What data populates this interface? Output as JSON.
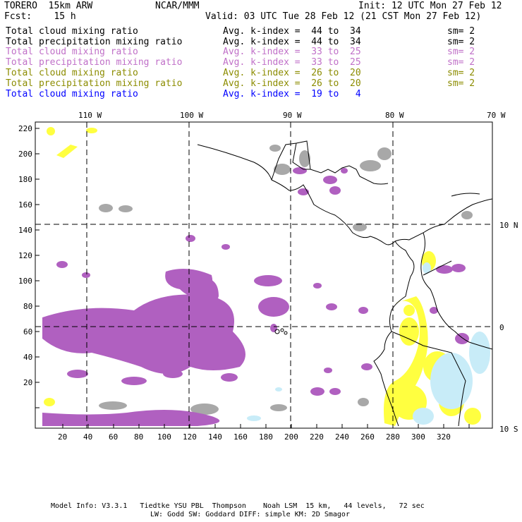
{
  "header": {
    "model": "TORERO  15km ARW",
    "org": "NCAR/MMM",
    "init": "Init: 12 UTC Mon 27 Feb 12",
    "fcst": "Fcst:    15 h",
    "valid": "Valid: 03 UTC Tue 28 Feb 12 (21 CST Mon 27 Feb 12)"
  },
  "legend": [
    {
      "field": "Total cloud mixing ratio",
      "kindex": "Avg. k-index =  44 to  34",
      "sm": "sm= 2",
      "color": "#000000"
    },
    {
      "field": "Total precipitation mixing ratio",
      "kindex": "Avg. k-index =  44 to  34",
      "sm": "sm= 2",
      "color": "#000000"
    },
    {
      "field": "Total cloud mixing ratio",
      "kindex": "Avg. k-index =  33 to  25",
      "sm": "sm= 2",
      "color": "#c070c8"
    },
    {
      "field": "Total precipitation mixing ratio",
      "kindex": "Avg. k-index =  33 to  25",
      "sm": "sm= 2",
      "color": "#c070c8"
    },
    {
      "field": "Total cloud mixing ratio",
      "kindex": "Avg. k-index =  26 to  20",
      "sm": "sm= 2",
      "color": "#8c8c00"
    },
    {
      "field": "Total precipitation mixing ratio",
      "kindex": "Avg. k-index =  26 to  20",
      "sm": "sm= 2",
      "color": "#8c8c00"
    },
    {
      "field": "Total cloud mixing ratio",
      "kindex": "Avg. k-index =  19 to   4",
      "sm": "",
      "color": "#0000ff"
    }
  ],
  "axes": {
    "top_lon": [
      "110 W",
      "100 W",
      "90 W",
      "80 W",
      "70 W"
    ],
    "right_lat": [
      "10 N",
      "0",
      "10 S"
    ],
    "left_y": [
      "220",
      "200",
      "180",
      "160",
      "140",
      "120",
      "100",
      "80",
      "60",
      "40",
      "20"
    ],
    "bottom_x": [
      "20",
      "40",
      "60",
      "80",
      "100",
      "120",
      "140",
      "160",
      "180",
      "200",
      "220",
      "240",
      "260",
      "280",
      "300",
      "320"
    ]
  },
  "colors": {
    "purple": "#b060c0",
    "gray": "#a8a8a8",
    "yellow": "#ffff40",
    "lightblue": "#c8ecf8"
  },
  "footer": {
    "line1": "Model Info: V3.3.1   Tiedtke YSU PBL  Thompson    Noah LSM  15 km,   44 levels,   72 sec",
    "line2": "LW: Godd SW: Goddard DIFF: simple KM: 2D Smagor"
  }
}
